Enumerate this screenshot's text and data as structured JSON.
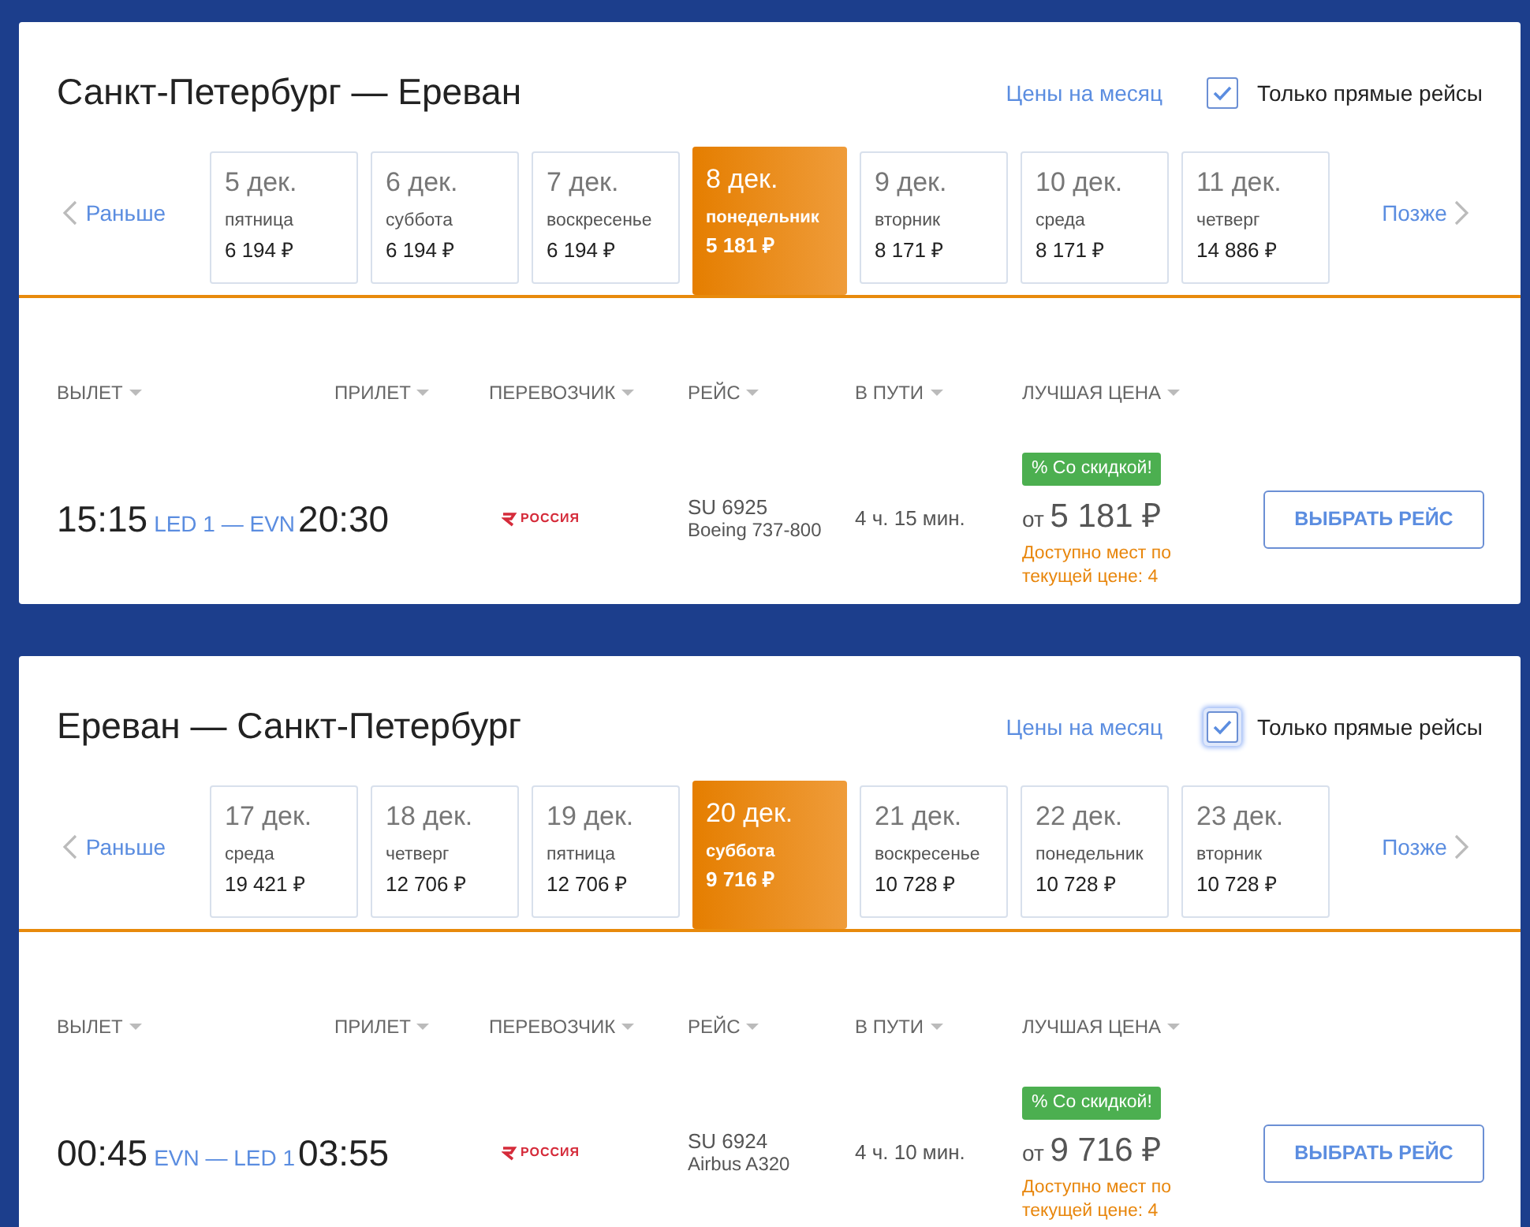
{
  "routes": [
    {
      "title": "Санкт-Петербург — Ереван",
      "month_prices": "Цены на месяц",
      "direct_only": {
        "label": "Только прямые рейсы",
        "checked": true,
        "focused": false
      },
      "earlier": "Раньше",
      "later": "Позже",
      "dates": [
        {
          "date": "5 дек.",
          "weekday": "пятница",
          "price": "6 194 ₽",
          "selected": false
        },
        {
          "date": "6 дек.",
          "weekday": "суббота",
          "price": "6 194 ₽",
          "selected": false
        },
        {
          "date": "7 дек.",
          "weekday": "воскресенье",
          "price": "6 194 ₽",
          "selected": false
        },
        {
          "date": "8 дек.",
          "weekday": "понедельник",
          "price": "5 181 ₽",
          "selected": true
        },
        {
          "date": "9 дек.",
          "weekday": "вторник",
          "price": "8 171 ₽",
          "selected": false
        },
        {
          "date": "10 дек.",
          "weekday": "среда",
          "price": "8 171 ₽",
          "selected": false
        },
        {
          "date": "11 дек.",
          "weekday": "четверг",
          "price": "14 886 ₽",
          "selected": false
        }
      ],
      "columns": [
        "ВЫЛЕТ",
        "ПРИЛЕТ",
        "ПЕРЕВОЗЧИК",
        "РЕЙС",
        "В ПУТИ",
        "ЛУЧШАЯ ЦЕНА"
      ],
      "flight": {
        "departure": "15:15",
        "route": "LED 1 — EVN",
        "arrival": "20:30",
        "airline": "РОССИЯ",
        "number": "SU 6925",
        "aircraft": "Boeing 737-800",
        "duration": "4 ч. 15 мин.",
        "badge": "% Со скидкой!",
        "price_prefix": "от",
        "price": "5 181 ₽",
        "availability": "Доступно мест по текущей цене: 4",
        "button": "ВЫБРАТЬ РЕЙС"
      }
    },
    {
      "title": "Ереван — Санкт-Петербург",
      "month_prices": "Цены на месяц",
      "direct_only": {
        "label": "Только прямые рейсы",
        "checked": true,
        "focused": true
      },
      "earlier": "Раньше",
      "later": "Позже",
      "dates": [
        {
          "date": "17 дек.",
          "weekday": "среда",
          "price": "19 421 ₽",
          "selected": false
        },
        {
          "date": "18 дек.",
          "weekday": "четверг",
          "price": "12 706 ₽",
          "selected": false
        },
        {
          "date": "19 дек.",
          "weekday": "пятница",
          "price": "12 706 ₽",
          "selected": false
        },
        {
          "date": "20 дек.",
          "weekday": "суббота",
          "price": "9 716 ₽",
          "selected": true
        },
        {
          "date": "21 дек.",
          "weekday": "воскресенье",
          "price": "10 728 ₽",
          "selected": false
        },
        {
          "date": "22 дек.",
          "weekday": "понедельник",
          "price": "10 728 ₽",
          "selected": false
        },
        {
          "date": "23 дек.",
          "weekday": "вторник",
          "price": "10 728 ₽",
          "selected": false
        }
      ],
      "columns": [
        "ВЫЛЕТ",
        "ПРИЛЕТ",
        "ПЕРЕВОЗЧИК",
        "РЕЙС",
        "В ПУТИ",
        "ЛУЧШАЯ ЦЕНА"
      ],
      "flight": {
        "departure": "00:45",
        "route": "EVN — LED 1",
        "arrival": "03:55",
        "airline": "РОССИЯ",
        "number": "SU 6924",
        "aircraft": "Airbus A320",
        "duration": "4 ч. 10 мин.",
        "badge": "% Со скидкой!",
        "price_prefix": "от",
        "price": "9 716 ₽",
        "availability": "Доступно мест по текущей цене: 4",
        "button": "ВЫБРАТЬ РЕЙС"
      }
    }
  ]
}
